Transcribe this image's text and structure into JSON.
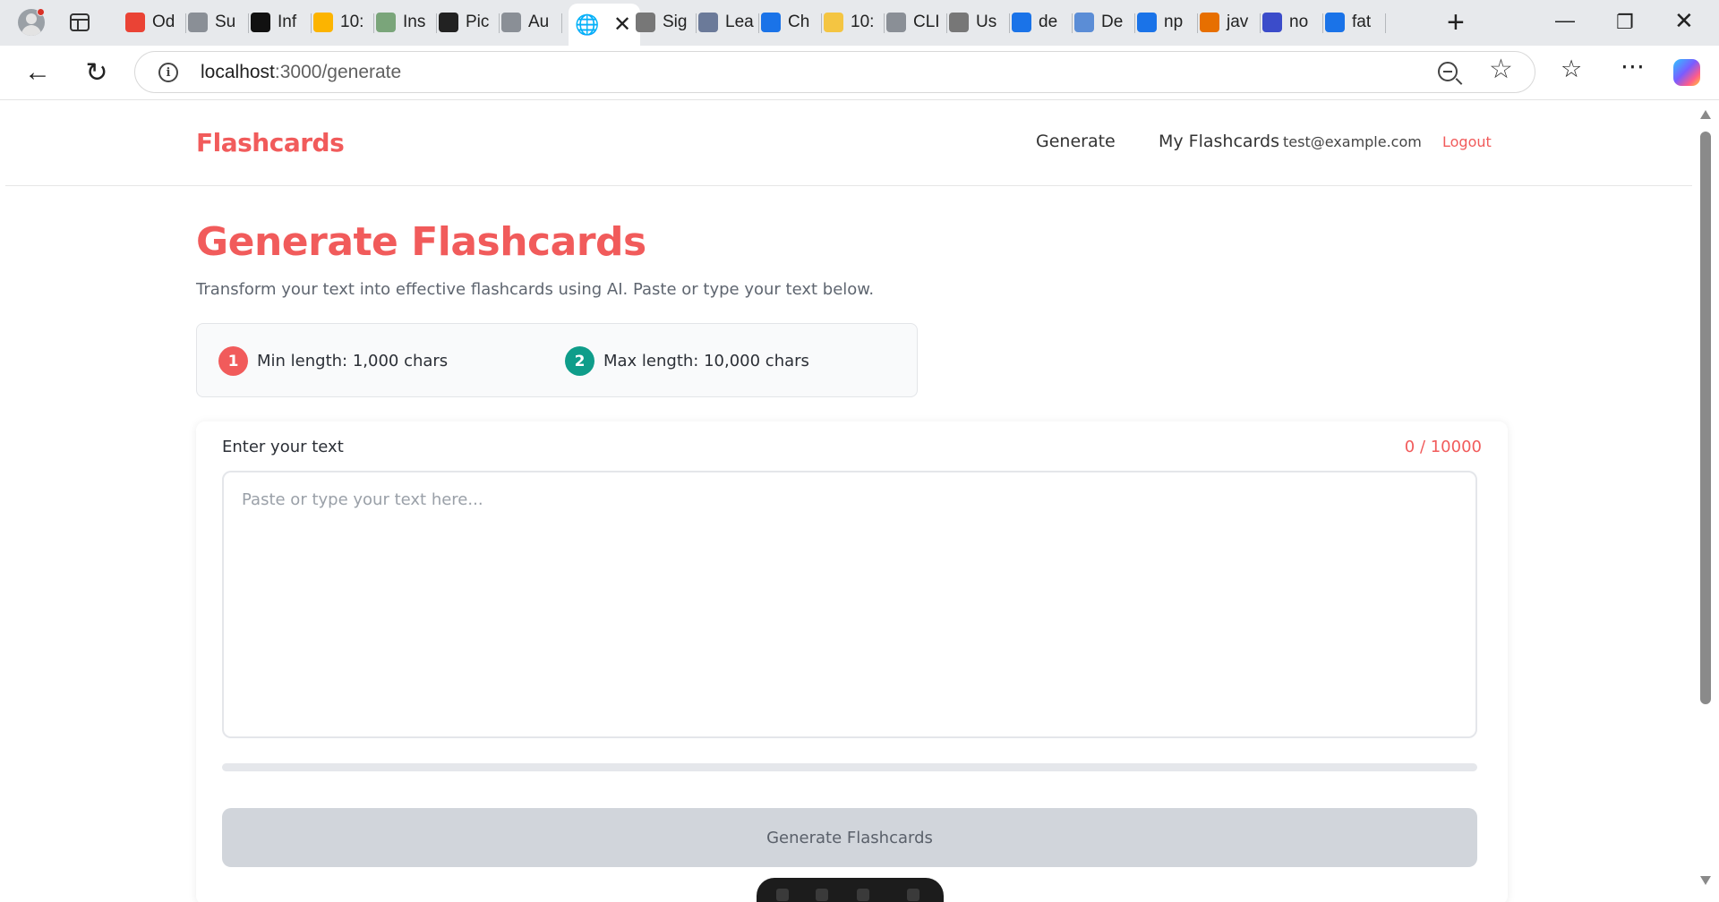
{
  "browser": {
    "tabs": [
      {
        "label": "Od",
        "icon": "gmail-icon",
        "color": "#ea4335"
      },
      {
        "label": "Su",
        "icon": "bolt-icon",
        "color": "#8a8f96"
      },
      {
        "label": "Inf",
        "icon": "shield-icon",
        "color": "#111111"
      },
      {
        "label": "10:",
        "icon": "airtable-icon",
        "color": "#fcb400"
      },
      {
        "label": "Ins",
        "icon": "leaf-icon",
        "color": "#7aa57a"
      },
      {
        "label": "Pic",
        "icon": "github-icon",
        "color": "#222222"
      },
      {
        "label": "Au",
        "icon": "bolt-icon",
        "color": "#8a8f96"
      },
      {
        "label": "Sig",
        "icon": "globe-icon",
        "color": "#777777"
      },
      {
        "label": "Lea",
        "icon": "image-icon",
        "color": "#6b7a99"
      },
      {
        "label": "Ch",
        "icon": "butterfly-icon",
        "color": "#1a73e8"
      },
      {
        "label": "10:",
        "icon": "sparkle-icon",
        "color": "#f4c542"
      },
      {
        "label": "CLI",
        "icon": "bolt-icon",
        "color": "#8a8f96"
      },
      {
        "label": "Us",
        "icon": "gear-icon",
        "color": "#777777"
      },
      {
        "label": "de",
        "icon": "search-icon",
        "color": "#1a73e8"
      },
      {
        "label": "De",
        "icon": "image-icon",
        "color": "#5b8dd6"
      },
      {
        "label": "np",
        "icon": "search-icon",
        "color": "#1a73e8"
      },
      {
        "label": "jav",
        "icon": "java-icon",
        "color": "#e76f00"
      },
      {
        "label": "no",
        "icon": "ts-icon",
        "color": "#3b4cca"
      },
      {
        "label": "fat",
        "icon": "search-icon",
        "color": "#1a73e8"
      }
    ],
    "url_host": "localhost",
    "url_path": ":3000/generate"
  },
  "header": {
    "brand": "Flashcards",
    "nav": {
      "generate": "Generate",
      "my_flashcards": "My Flashcards"
    },
    "user_email": "test@example.com",
    "logout": "Logout"
  },
  "main": {
    "title": "Generate Flashcards",
    "subtitle": "Transform your text into effective flashcards using AI. Paste or type your text below.",
    "limits": [
      {
        "badge": "1",
        "label": "Min length: 1,000 chars",
        "color": "#f15b5b"
      },
      {
        "badge": "2",
        "label": "Max length: 10,000 chars",
        "color": "#0f9d8a"
      }
    ],
    "input": {
      "label": "Enter your text",
      "counter": "0 / 10000",
      "value": "",
      "placeholder": "Paste or type your text here...",
      "progress": 0
    },
    "submit_label": "Generate Flashcards"
  },
  "colors": {
    "accent": "#f15b5b",
    "teal": "#0f9d8a",
    "button_disabled": "#d1d5db"
  }
}
